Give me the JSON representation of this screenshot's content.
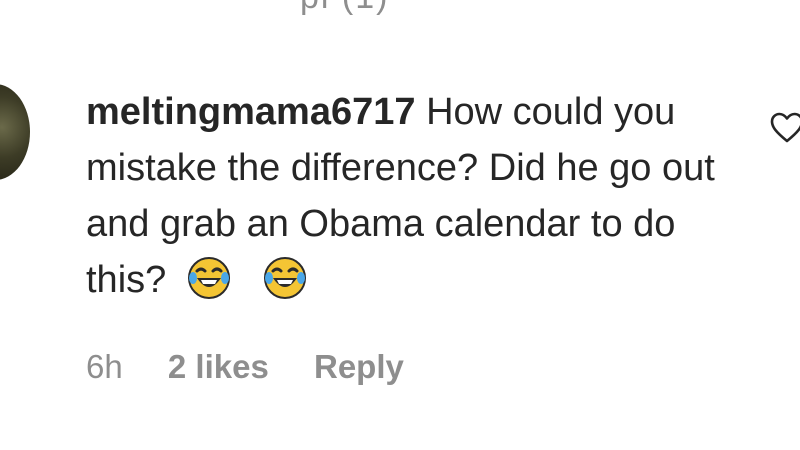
{
  "top_partial_text": "pl (1)",
  "comment": {
    "username": "meltingmama6717",
    "text": "How could you mistake the difference? Did he go out and grab an Obama calendar to do this?",
    "emojis": [
      "face-with-tears-of-joy",
      "face-with-tears-of-joy"
    ]
  },
  "meta": {
    "time": "6h",
    "likes": "2 likes",
    "reply": "Reply"
  },
  "icons": {
    "like": "heart-outline-icon"
  },
  "colors": {
    "text": "#262626",
    "secondary": "#8e8e8e",
    "background": "#ffffff"
  }
}
